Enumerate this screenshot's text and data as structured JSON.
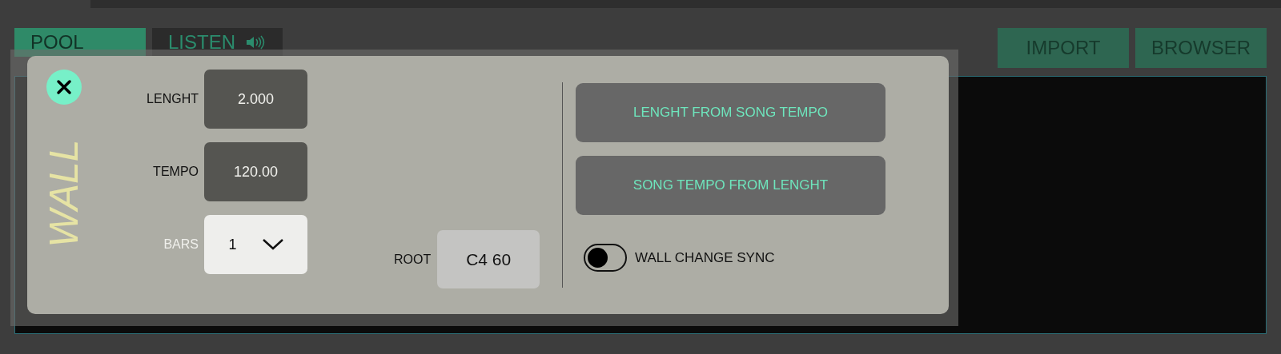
{
  "tabs": [
    {
      "label": "POOL",
      "selected": true
    },
    {
      "label": "LISTEN",
      "selected": false
    }
  ],
  "actions": [
    "IMPORT",
    "BROWSER"
  ],
  "dialog": {
    "title": "WALL",
    "fields": [
      {
        "kind": "value",
        "label": "LENGHT",
        "value": "2.000"
      },
      {
        "kind": "value",
        "label": "TEMPO",
        "value": "120.00"
      },
      {
        "kind": "dropdown",
        "label": "BARS",
        "value": "1"
      }
    ],
    "root": {
      "label": "ROOT",
      "value": "C4 60"
    },
    "buttons": [
      "LENGHT FROM SONG TEMPO",
      "SONG TEMPO FROM LENGHT"
    ],
    "sync_toggle": {
      "label": "WALL CHANGE SYNC",
      "on": false
    }
  }
}
